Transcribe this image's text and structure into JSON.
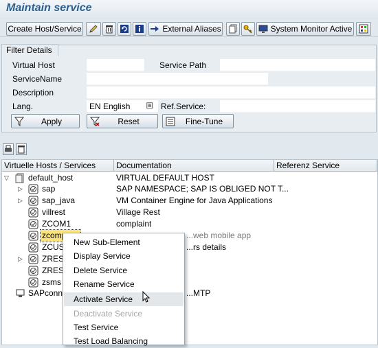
{
  "title": "Maintain service",
  "toolbar": {
    "create_host_label": "Create Host/Service",
    "external_aliases_label": "External Aliases",
    "system_monitor_label": "System Monitor Active",
    "icons": [
      "pencil-icon",
      "trash-icon",
      "refresh-icon",
      "info-icon",
      "arrow-right-icon",
      "copy-icon",
      "key-icon",
      "monitor-icon",
      "grid-icon"
    ]
  },
  "filter": {
    "tab_label": "Filter Details",
    "virtual_host_label": "Virtual Host",
    "virtual_host_value": "",
    "service_path_label": "Service Path",
    "service_path_value": "",
    "service_name_label": "ServiceName",
    "service_name_value": "",
    "description_label": "Description",
    "description_value": "",
    "lang_label": "Lang.",
    "lang_value": "EN English",
    "ref_service_label": "Ref.Service:",
    "ref_service_value": "",
    "apply_label": "Apply",
    "reset_label": "Reset",
    "fine_tune_label": "Fine-Tune"
  },
  "tree": {
    "columns": [
      "Virtuelle Hosts / Services",
      "Documentation",
      "Referenz Service"
    ],
    "rows": [
      {
        "name": "default_host",
        "doc": "VIRTUAL DEFAULT HOST",
        "ref": ""
      },
      {
        "name": "sap",
        "doc": "SAP NAMESPACE; SAP IS OBLIGED NOT T...",
        "ref": ""
      },
      {
        "name": "sap_java",
        "doc": "VM Container Engine for Java Applications",
        "ref": ""
      },
      {
        "name": "villrest",
        "doc": "Village Rest",
        "ref": ""
      },
      {
        "name": "ZCOM1",
        "doc": "complaint",
        "ref": ""
      },
      {
        "name": "zcomp",
        "doc": "...web mobile app",
        "ref": ""
      },
      {
        "name": "ZCUST",
        "doc": "...rs details",
        "ref": ""
      },
      {
        "name": "ZREST",
        "doc": "",
        "ref": ""
      },
      {
        "name": "ZREST",
        "doc": "",
        "ref": ""
      },
      {
        "name": "zsms",
        "doc": "",
        "ref": ""
      },
      {
        "name": "SAPconne",
        "doc": "...MTP",
        "ref": ""
      }
    ]
  },
  "context_menu": {
    "items": [
      {
        "label": "New Sub-Element",
        "enabled": true
      },
      {
        "label": "Display Service",
        "enabled": true
      },
      {
        "label": "Delete Service",
        "enabled": true
      },
      {
        "label": "Rename Service",
        "enabled": true
      },
      {
        "label": "Activate Service",
        "enabled": true
      },
      {
        "label": "Deactivate Service",
        "enabled": false
      },
      {
        "label": "Test Service",
        "enabled": true
      },
      {
        "label": "Test Load Balancing",
        "enabled": true
      }
    ]
  },
  "colors": {
    "title_color": "#2a5f8f",
    "selection_color": "#fbe27a",
    "background": "#e1e9ee"
  }
}
